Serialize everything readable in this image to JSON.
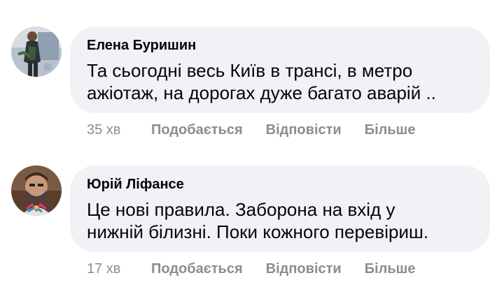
{
  "comments": [
    {
      "author": "Елена Буришин",
      "text": "Та сьогодні весь Київ в трансі, в метро\nажіотаж, на дорогах дуже багато аварій ..",
      "time": "35 хв",
      "like_label": "Подобається",
      "reply_label": "Відповісти",
      "more_label": "Більше"
    },
    {
      "author": "Юрій Ліфансе",
      "text": "Це нові правила. Заборона на вхід у\nнижній білизні. Поки кожного перевіриш.",
      "time": "17 хв",
      "like_label": "Подобається",
      "reply_label": "Відповісти",
      "more_label": "Більше"
    }
  ]
}
